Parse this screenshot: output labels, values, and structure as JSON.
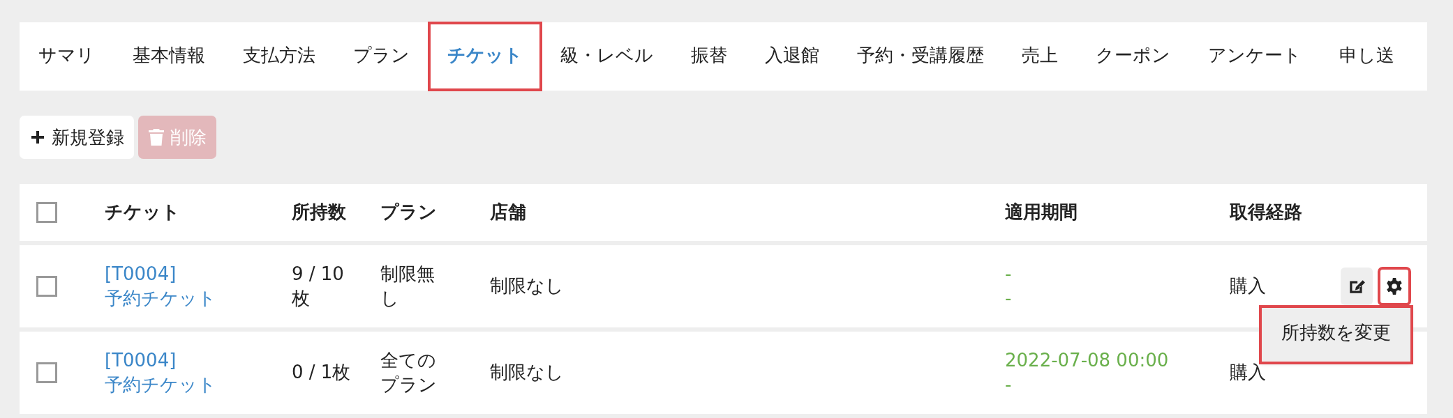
{
  "tabs": [
    {
      "label": "サマリ",
      "selected": false,
      "highlighted": false
    },
    {
      "label": "基本情報",
      "selected": false,
      "highlighted": false
    },
    {
      "label": "支払方法",
      "selected": false,
      "highlighted": false
    },
    {
      "label": "プラン",
      "selected": false,
      "highlighted": false
    },
    {
      "label": "チケット",
      "selected": true,
      "highlighted": true
    },
    {
      "label": "級・レベル",
      "selected": false,
      "highlighted": false
    },
    {
      "label": "振替",
      "selected": false,
      "highlighted": false
    },
    {
      "label": "入退館",
      "selected": false,
      "highlighted": false
    },
    {
      "label": "予約・受講履歴",
      "selected": false,
      "highlighted": false
    },
    {
      "label": "売上",
      "selected": false,
      "highlighted": false
    },
    {
      "label": "クーポン",
      "selected": false,
      "highlighted": false
    },
    {
      "label": "アンケート",
      "selected": false,
      "highlighted": false
    },
    {
      "label": "申し送",
      "selected": false,
      "highlighted": false
    }
  ],
  "toolbar": [
    {
      "kind": "add",
      "label": "新規登録",
      "disabled": false
    },
    {
      "kind": "delete",
      "label": "削除",
      "disabled": true
    }
  ],
  "table": {
    "select_all_checked": false,
    "columns": [
      "チケット",
      "所持数",
      "プラン",
      "店舗",
      "適用期間",
      "取得経路"
    ],
    "rows": [
      {
        "checked": false,
        "ticket_code": "[T0004]",
        "ticket_name": "予約チケット",
        "count": "9 / 10 枚",
        "plan": "制限無し",
        "store": "制限なし",
        "period_start": "-",
        "period_end": "-",
        "source": "購入",
        "actions": {
          "gear_highlighted": true,
          "menu_open": true,
          "menu_highlighted": true,
          "menu_items": [
            "所持数を変更"
          ]
        }
      },
      {
        "checked": false,
        "ticket_code": "[T0004]",
        "ticket_name": "予約チケット",
        "count": "0 / 1枚",
        "plan": "全てのプラン",
        "store": "制限なし",
        "period_start": "2022-07-08 00:00",
        "period_end": "-",
        "source": "購入"
      }
    ]
  }
}
